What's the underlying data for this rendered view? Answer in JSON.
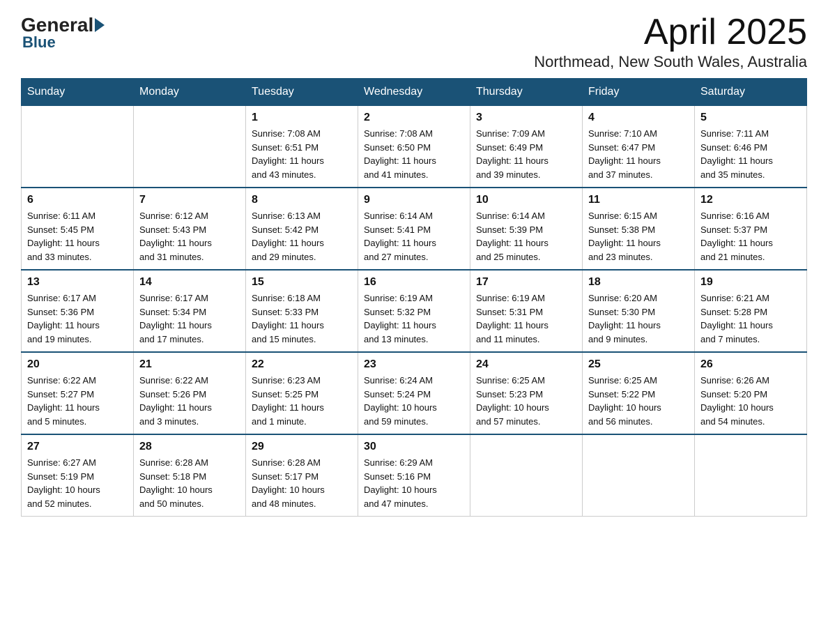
{
  "header": {
    "logo_text": "General",
    "logo_blue": "Blue",
    "month": "April 2025",
    "location": "Northmead, New South Wales, Australia"
  },
  "days_of_week": [
    "Sunday",
    "Monday",
    "Tuesday",
    "Wednesday",
    "Thursday",
    "Friday",
    "Saturday"
  ],
  "weeks": [
    [
      {
        "date": "",
        "info": ""
      },
      {
        "date": "",
        "info": ""
      },
      {
        "date": "1",
        "info": "Sunrise: 7:08 AM\nSunset: 6:51 PM\nDaylight: 11 hours\nand 43 minutes."
      },
      {
        "date": "2",
        "info": "Sunrise: 7:08 AM\nSunset: 6:50 PM\nDaylight: 11 hours\nand 41 minutes."
      },
      {
        "date": "3",
        "info": "Sunrise: 7:09 AM\nSunset: 6:49 PM\nDaylight: 11 hours\nand 39 minutes."
      },
      {
        "date": "4",
        "info": "Sunrise: 7:10 AM\nSunset: 6:47 PM\nDaylight: 11 hours\nand 37 minutes."
      },
      {
        "date": "5",
        "info": "Sunrise: 7:11 AM\nSunset: 6:46 PM\nDaylight: 11 hours\nand 35 minutes."
      }
    ],
    [
      {
        "date": "6",
        "info": "Sunrise: 6:11 AM\nSunset: 5:45 PM\nDaylight: 11 hours\nand 33 minutes."
      },
      {
        "date": "7",
        "info": "Sunrise: 6:12 AM\nSunset: 5:43 PM\nDaylight: 11 hours\nand 31 minutes."
      },
      {
        "date": "8",
        "info": "Sunrise: 6:13 AM\nSunset: 5:42 PM\nDaylight: 11 hours\nand 29 minutes."
      },
      {
        "date": "9",
        "info": "Sunrise: 6:14 AM\nSunset: 5:41 PM\nDaylight: 11 hours\nand 27 minutes."
      },
      {
        "date": "10",
        "info": "Sunrise: 6:14 AM\nSunset: 5:39 PM\nDaylight: 11 hours\nand 25 minutes."
      },
      {
        "date": "11",
        "info": "Sunrise: 6:15 AM\nSunset: 5:38 PM\nDaylight: 11 hours\nand 23 minutes."
      },
      {
        "date": "12",
        "info": "Sunrise: 6:16 AM\nSunset: 5:37 PM\nDaylight: 11 hours\nand 21 minutes."
      }
    ],
    [
      {
        "date": "13",
        "info": "Sunrise: 6:17 AM\nSunset: 5:36 PM\nDaylight: 11 hours\nand 19 minutes."
      },
      {
        "date": "14",
        "info": "Sunrise: 6:17 AM\nSunset: 5:34 PM\nDaylight: 11 hours\nand 17 minutes."
      },
      {
        "date": "15",
        "info": "Sunrise: 6:18 AM\nSunset: 5:33 PM\nDaylight: 11 hours\nand 15 minutes."
      },
      {
        "date": "16",
        "info": "Sunrise: 6:19 AM\nSunset: 5:32 PM\nDaylight: 11 hours\nand 13 minutes."
      },
      {
        "date": "17",
        "info": "Sunrise: 6:19 AM\nSunset: 5:31 PM\nDaylight: 11 hours\nand 11 minutes."
      },
      {
        "date": "18",
        "info": "Sunrise: 6:20 AM\nSunset: 5:30 PM\nDaylight: 11 hours\nand 9 minutes."
      },
      {
        "date": "19",
        "info": "Sunrise: 6:21 AM\nSunset: 5:28 PM\nDaylight: 11 hours\nand 7 minutes."
      }
    ],
    [
      {
        "date": "20",
        "info": "Sunrise: 6:22 AM\nSunset: 5:27 PM\nDaylight: 11 hours\nand 5 minutes."
      },
      {
        "date": "21",
        "info": "Sunrise: 6:22 AM\nSunset: 5:26 PM\nDaylight: 11 hours\nand 3 minutes."
      },
      {
        "date": "22",
        "info": "Sunrise: 6:23 AM\nSunset: 5:25 PM\nDaylight: 11 hours\nand 1 minute."
      },
      {
        "date": "23",
        "info": "Sunrise: 6:24 AM\nSunset: 5:24 PM\nDaylight: 10 hours\nand 59 minutes."
      },
      {
        "date": "24",
        "info": "Sunrise: 6:25 AM\nSunset: 5:23 PM\nDaylight: 10 hours\nand 57 minutes."
      },
      {
        "date": "25",
        "info": "Sunrise: 6:25 AM\nSunset: 5:22 PM\nDaylight: 10 hours\nand 56 minutes."
      },
      {
        "date": "26",
        "info": "Sunrise: 6:26 AM\nSunset: 5:20 PM\nDaylight: 10 hours\nand 54 minutes."
      }
    ],
    [
      {
        "date": "27",
        "info": "Sunrise: 6:27 AM\nSunset: 5:19 PM\nDaylight: 10 hours\nand 52 minutes."
      },
      {
        "date": "28",
        "info": "Sunrise: 6:28 AM\nSunset: 5:18 PM\nDaylight: 10 hours\nand 50 minutes."
      },
      {
        "date": "29",
        "info": "Sunrise: 6:28 AM\nSunset: 5:17 PM\nDaylight: 10 hours\nand 48 minutes."
      },
      {
        "date": "30",
        "info": "Sunrise: 6:29 AM\nSunset: 5:16 PM\nDaylight: 10 hours\nand 47 minutes."
      },
      {
        "date": "",
        "info": ""
      },
      {
        "date": "",
        "info": ""
      },
      {
        "date": "",
        "info": ""
      }
    ]
  ]
}
